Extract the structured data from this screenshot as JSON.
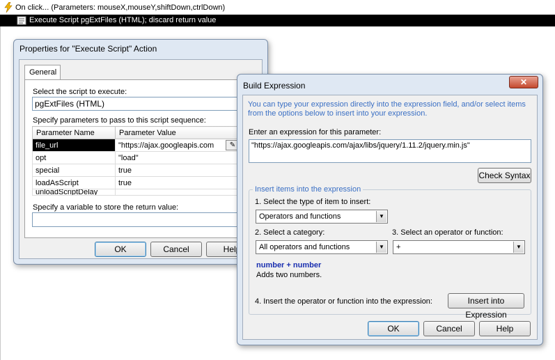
{
  "event": {
    "text": "On click... (Parameters: mouseX,mouseY,shiftDown,ctrlDown)"
  },
  "action": {
    "text": "Execute Script pgExtFiles (HTML); discard return value"
  },
  "props": {
    "title": "Properties for \"Execute Script\" Action",
    "tab": "General",
    "select_script_label": "Select the script to execute:",
    "script_value": "pgExtFiles (HTML)",
    "params_label": "Specify parameters to pass to this script sequence:",
    "col_name": "Parameter Name",
    "col_value": "Parameter Value",
    "rows": [
      {
        "name": "file_url",
        "value": "\"https://ajax.googleapis.com"
      },
      {
        "name": "opt",
        "value": "\"load\""
      },
      {
        "name": "special",
        "value": "true"
      },
      {
        "name": "loadAsScript",
        "value": "true"
      },
      {
        "name": "unloadScriptDelay",
        "value": ""
      }
    ],
    "variable_label": "Specify a variable to store the return value:",
    "ok": "OK",
    "cancel": "Cancel",
    "help": "Help"
  },
  "build": {
    "title": "Build Expression",
    "info": "You can type your expression directly into the expression field, and/or select items from the options below to insert into your expression.",
    "enter_label": "Enter an expression for this parameter:",
    "expression": "\"https://ajax.googleapis.com/ajax/libs/jquery/1.11.2/jquery.min.js\"",
    "check_syntax": "Check Syntax",
    "group_label": "Insert items into the expression",
    "step1": "1. Select the type of item to insert:",
    "type_value": "Operators and functions",
    "step2": "2. Select a category:",
    "category_value": "All operators and functions",
    "step3": "3. Select an operator or function:",
    "operator_value": "+",
    "syntax_left": "number",
    "syntax_op": "+",
    "syntax_right": "number",
    "description": "Adds two numbers.",
    "step4": "4. Insert the operator or function into the expression:",
    "insert_button": "Insert into Expression",
    "ok": "OK",
    "cancel": "Cancel",
    "help": "Help"
  }
}
